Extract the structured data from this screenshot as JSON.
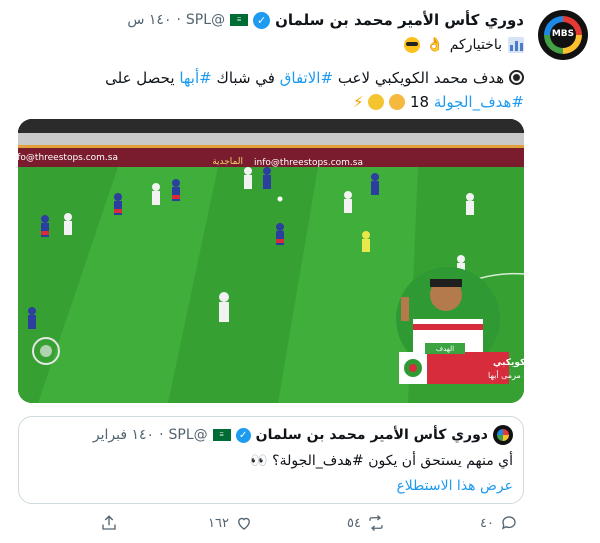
{
  "tweet": {
    "author_name": "دوري كأس الأمير محمد بن سلمان",
    "handle": "@SPL",
    "time": "١٤٠ س",
    "line1_text": "باختياركم",
    "body_prefix": "هدف محمد الكويكبي لاعب",
    "tag_ettifaq": "#الاتفاق",
    "body_mid": "في شباك",
    "tag_abha": "#أبها",
    "body_suffix": "يحصل على",
    "tag_goal_round": "#هدف_الجولة",
    "number": "18",
    "avatar_text": "MBS"
  },
  "media": {
    "board_url_1": "info@threestops.com.sa",
    "board_url_2": "info@threestops.com.sa",
    "board_brand": "الماجدية",
    "lower_third_name": "محمد الكويكبي",
    "lower_third_sub": "في مرمى أبها",
    "badge_label": "الهدف",
    "colors": {
      "pitch": "#3fae3a",
      "pitch_stripe": "#36a032",
      "board": "#7a1b2e",
      "lower_third_red": "#d62c3c"
    }
  },
  "quote": {
    "author_name": "دوري كأس الأمير محمد بن سلمان",
    "handle": "@SPL",
    "time": "١٤٠ فبراير",
    "text": "أي منهم يستحق أن يكون #هدف_الجولة؟ 👀",
    "poll_link": "عرض هذا الاستطلاع"
  },
  "actions": {
    "replies": "٤٠",
    "retweets": "٥٤",
    "likes": "١٦٢"
  },
  "colors": {
    "accent": "#1d9bf0",
    "muted": "#536471"
  }
}
